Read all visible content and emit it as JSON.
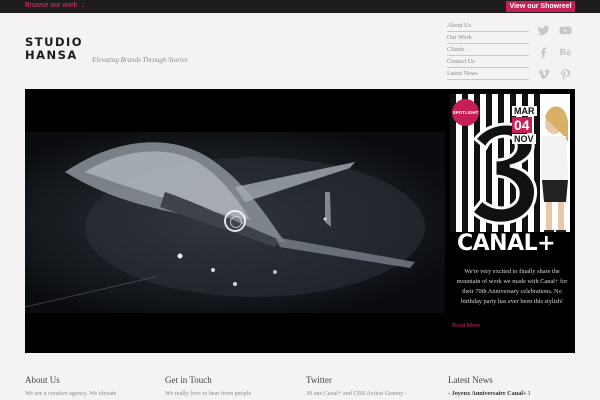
{
  "topbar": {
    "browse_label": "Browse our work",
    "browse_arrow": "↓",
    "showreel_label": "View our Showreel"
  },
  "brand": {
    "logo_line1": "STUDIO",
    "logo_line2": "HANSA",
    "tagline": "Elevating Brands Through Stories"
  },
  "nav": {
    "items": [
      "About Us",
      "Our Work",
      "Clients",
      "Contact Us",
      "Latest News"
    ]
  },
  "social": [
    "twitter-icon",
    "youtube-icon",
    "facebook-icon",
    "behance-icon",
    "vimeo-icon",
    "pinterest-icon"
  ],
  "spotlight": {
    "badge": "SPOTLIGHT",
    "date_top": "MAR",
    "date_num": "04",
    "date_bottom": "NOV",
    "brand": "CANAL+",
    "text": "We're very excited to finally share the mountain of work we made with Canal+ for their 70th Anniversary celebrations. No birthday party has ever been this stylish!",
    "read_more": "Read More"
  },
  "footer": {
    "about_title": "About Us",
    "about_text": "We are a creative agency. We elevate",
    "contact_title": "Get in Touch",
    "contact_text": "We really love to hear from people",
    "twitter_title": "Twitter",
    "twitter_text": "30 ans Canal+ and CBS Action Granny -",
    "news_title": "Latest News",
    "news_text": "- Joyeux Anniversaire Canal+ !"
  },
  "colors": {
    "accent": "#c51f55",
    "dark": "#1f1c1e",
    "background": "#f4f2f4"
  }
}
